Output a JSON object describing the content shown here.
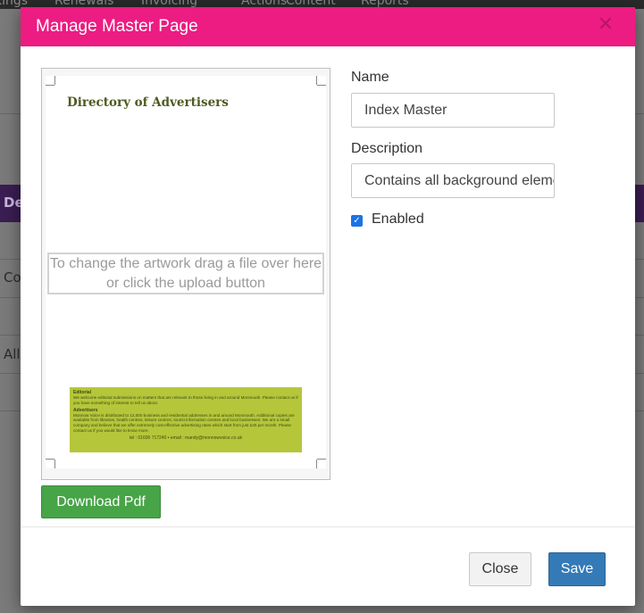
{
  "background": {
    "nav_items": [
      "kings",
      "Renewals",
      "Invoicing",
      "Actions",
      "Content",
      "Reports"
    ],
    "section_bar": "De",
    "rows": [
      "Co",
      "All"
    ]
  },
  "modal": {
    "title": "Manage Master Page",
    "close_icon": "close-icon",
    "preview": {
      "page_heading": "Directory of Advertisers",
      "dropzone_text": "To change the artwork drag a file over here or click the upload button",
      "ad": {
        "editorial_heading": "Editorial",
        "editorial_text": "We welcome editorial submissions on matters that are relevant to those living in and around Monmouth. Please contact us if you have something of interest to tell us about.",
        "advertisers_heading": "Advertisers",
        "advertisers_text": "Monnow Voice is distributed to 12,000 business and residential addresses in and around Monmouth. Additional copies are available from libraries, health centres, leisure centres, tourist information centres and local businesses. We are a small company and believe that we offer extremely cost-effective advertising rates which start from just £25 per month.  Please contact us if you would like to know more.",
        "contact": "tel : 01600 717240 • email : mandy@monnowvoice.co.uk"
      }
    },
    "download_button": "Download Pdf",
    "form": {
      "name_label": "Name",
      "name_value": "Index Master",
      "description_label": "Description",
      "description_value": "Contains all background elements",
      "enabled_label": "Enabled",
      "enabled_checked": true
    },
    "footer": {
      "close_button": "Close",
      "save_button": "Save"
    }
  },
  "colors": {
    "header": "#ec1c82",
    "download": "#47a447",
    "save": "#337ab7",
    "checkbox": "#1a73e8",
    "ad_background": "#b5c63a"
  }
}
